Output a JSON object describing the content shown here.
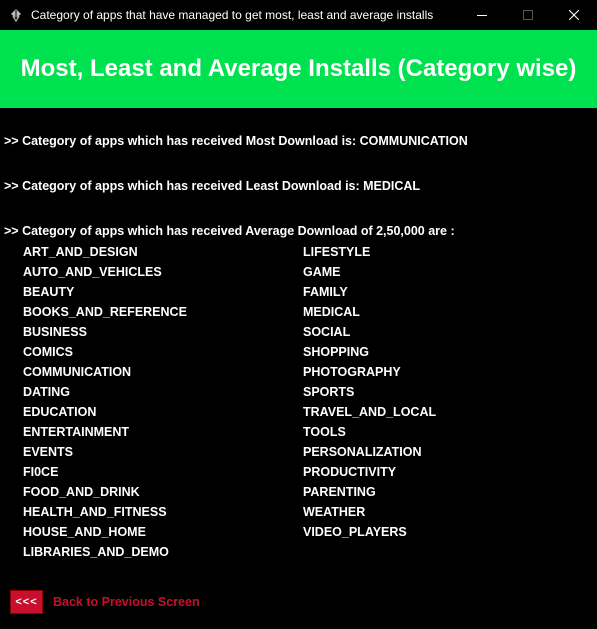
{
  "window": {
    "title": "Category of apps that have managed to get most, least and average installs",
    "app_icon": "feather-quill-icon",
    "controls": {
      "minimize": "—",
      "maximize": "☐",
      "close": "✕"
    }
  },
  "header": {
    "title": "Most, Least and Average Installs (Category wise)",
    "background_color": "#00e14f"
  },
  "results": {
    "most_download": ">> Category of apps which has received Most Download is:  COMMUNICATION",
    "least_download": ">> Category of apps which has received Least Download is:  MEDICAL",
    "average_download": ">> Category of apps which has received Average Download of 2,50,000 are :"
  },
  "average_categories": {
    "left": [
      "ART_AND_DESIGN",
      "AUTO_AND_VEHICLES",
      "BEAUTY",
      "BOOKS_AND_REFERENCE",
      "BUSINESS",
      "COMICS",
      "COMMUNICATION",
      "DATING",
      "EDUCATION",
      "ENTERTAINMENT",
      "EVENTS",
      "FI0CE",
      "FOOD_AND_DRINK",
      "HEALTH_AND_FITNESS",
      "HOUSE_AND_HOME",
      "LIBRARIES_AND_DEMO"
    ],
    "right": [
      "LIFESTYLE",
      "GAME",
      "FAMILY",
      "MEDICAL",
      "SOCIAL",
      "SHOPPING",
      "PHOTOGRAPHY",
      "SPORTS",
      "TRAVEL_AND_LOCAL",
      "TOOLS",
      "PERSONALIZATION",
      "PRODUCTIVITY",
      "PARENTING",
      "WEATHER",
      "VIDEO_PLAYERS"
    ]
  },
  "footer": {
    "back_button_label": "<<<",
    "back_link_text": "Back to Previous Screen",
    "accent_color": "#c8102e"
  }
}
